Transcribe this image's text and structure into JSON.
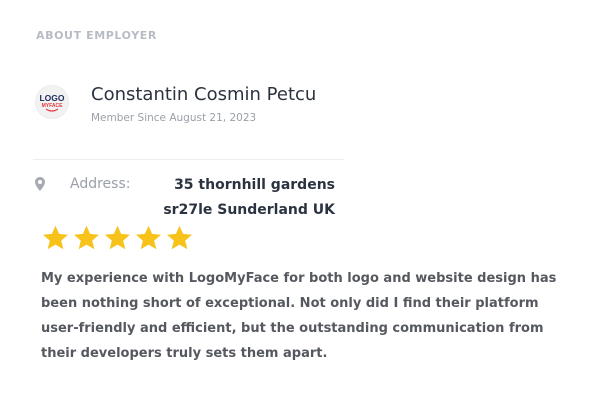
{
  "section": {
    "title": "ABOUT EMPLOYER"
  },
  "employer": {
    "logo_icon": "logomyface-logo",
    "logo_text_top": "LOGO",
    "logo_text_bottom": "MYFACE",
    "name": "Constantin Cosmin Petcu",
    "member_since": "Member Since August 21, 2023"
  },
  "address": {
    "icon": "map-pin-icon",
    "label": "Address:",
    "line1": "35 thornhill gardens",
    "line2": "sr27le Sunderland UK"
  },
  "review": {
    "rating": 5,
    "max_rating": 5,
    "star_color": "#f7c31a",
    "text": "My experience with LogoMyFace for both logo and website design has been nothing short of exceptional. Not only did I find their platform user-friendly and efficient, but the outstanding communication from their developers truly sets them apart."
  }
}
